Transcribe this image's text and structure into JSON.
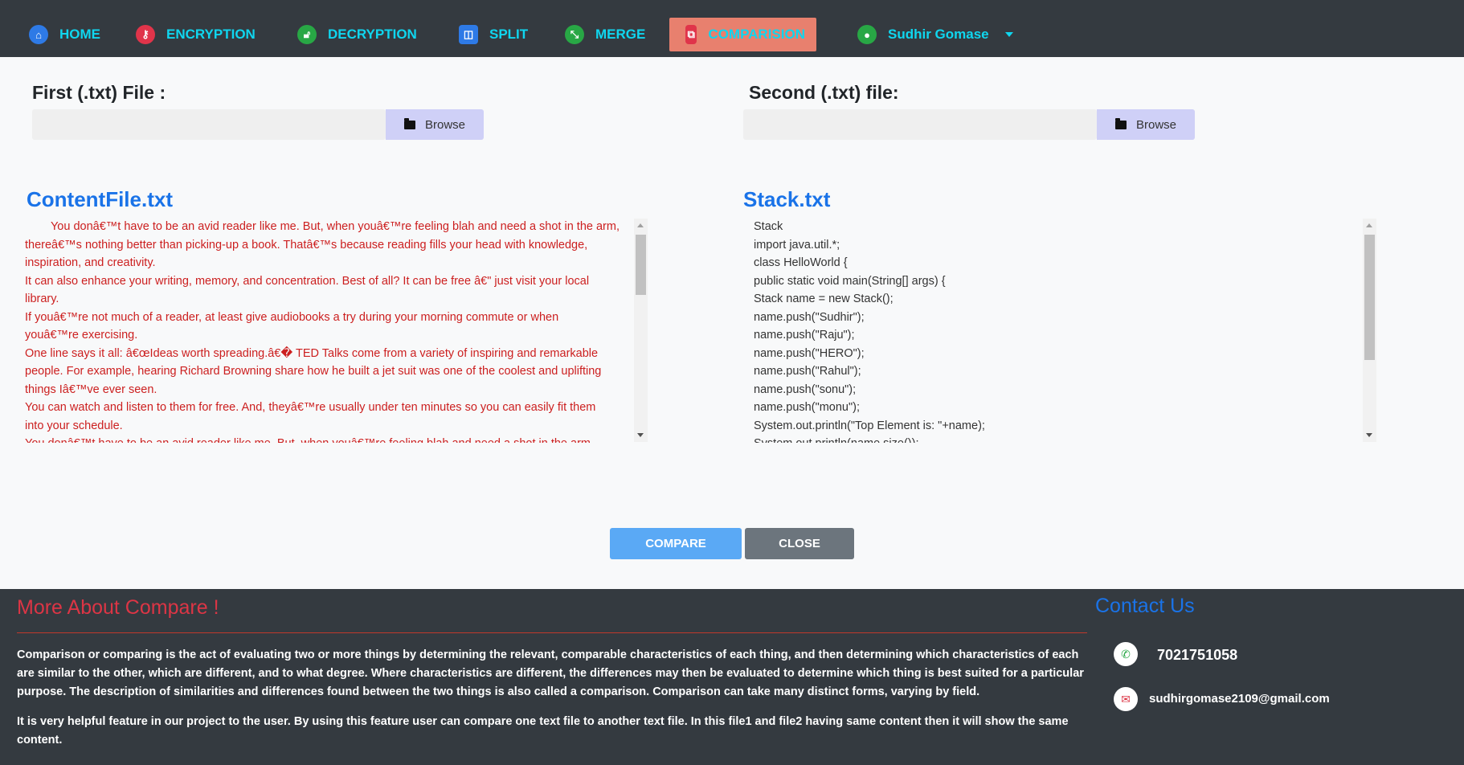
{
  "nav": {
    "items": [
      {
        "label": "HOME",
        "icon": "home-icon"
      },
      {
        "label": "ENCRYPTION",
        "icon": "key-icon"
      },
      {
        "label": "DECRYPTION",
        "icon": "unlock-icon"
      },
      {
        "label": "SPLIT",
        "icon": "split-icon"
      },
      {
        "label": "MERGE",
        "icon": "merge-icon"
      },
      {
        "label": "COMPARISION",
        "icon": "copy-icon"
      }
    ],
    "user": "Sudhir Gomase"
  },
  "form": {
    "first_label": "First (.txt) File :",
    "second_label": "Second (.txt) file:",
    "browse_label": "Browse",
    "first_value": "",
    "second_value": ""
  },
  "panels": {
    "left_title": "ContentFile.txt",
    "right_title": "Stack.txt",
    "left_lines": [
      "        You donâ€™t have to be an avid reader like me. But, when youâ€™re feeling blah and need a shot in the arm,",
      "thereâ€™s nothing better than picking-up a book. Thatâ€™s because reading fills your head with knowledge,",
      "inspiration, and creativity.",
      "It can also enhance your writing, memory, and concentration. Best of all? It can be free â€\" just visit your local",
      "library.",
      "If youâ€™re not much of a reader, at least give audiobooks a try during your morning commute or when",
      "youâ€™re exercising.",
      "One line says it all: â€œIdeas worth spreading.â€� TED Talks come from a variety of inspiring and remarkable",
      "people. For example, hearing Richard Browning share how he built a jet suit was one of the coolest and uplifting",
      "things Iâ€™ve ever seen.",
      "You can watch and listen to them for free. And, theyâ€™re usually under ten minutes so you can easily fit them",
      "into your schedule.",
      "You donâ€™t have to be an avid reader like me. But, when youâ€™re feeling blah and need a shot in the arm,"
    ],
    "right_lines": [
      "Stack",
      "import java.util.*;",
      "class HelloWorld {",
      "public static void main(String[] args) {",
      "Stack name = new Stack();",
      "name.push(\"Sudhir\");",
      "name.push(\"Raju\");",
      "name.push(\"HERO\");",
      "name.push(\"Rahul\");",
      "name.push(\"sonu\");",
      "name.push(\"monu\");",
      "System.out.println(\"Top Element is: \"+name);",
      "System.out.println(name.size());"
    ]
  },
  "buttons": {
    "compare": "COMPARE",
    "close": "CLOSE"
  },
  "footer": {
    "title": "More About Compare !",
    "para1": "Comparison or comparing is the act of evaluating two or more things by determining the relevant, comparable characteristics of each thing, and then determining which characteristics of each are similar to the other, which are different, and to what degree. Where characteristics are different, the differences may then be evaluated to determine which thing is best suited for a particular purpose. The description of similarities and differences found between the two things is also called a comparison. Comparison can take many distinct forms, varying by field.",
    "para2": "It is very helpful feature in our project to the user. By using this feature user can compare one text file to another text file. In this file1 and file2 having same content then it will show the same content.",
    "contact_title": "Contact Us",
    "phone": "7021751058",
    "email": "sudhirgomase2109@gmail.com"
  },
  "colors": {
    "nav_bg": "#343a40",
    "nav_text": "#0fd6ef",
    "active_tab": "#e8806e",
    "compare_btn": "#5aa9f5",
    "close_btn": "#6c757d",
    "footer_title": "#dc3545",
    "contact_title": "#1a73e8"
  }
}
